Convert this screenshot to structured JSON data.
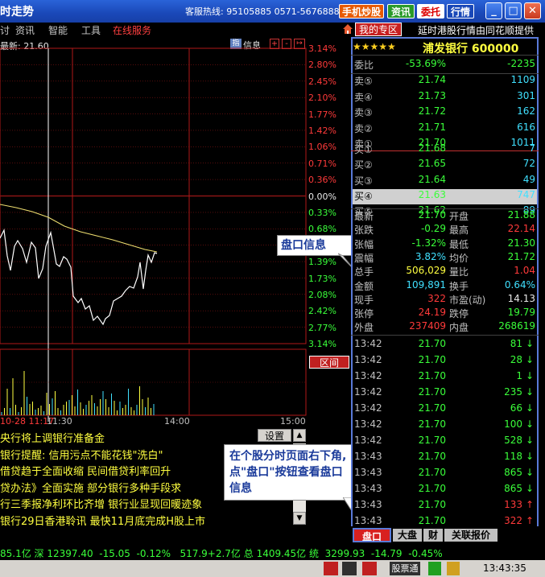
{
  "titlebar": {
    "title": "时走势",
    "hotline": "客服热线: 95105885  0571-56768888",
    "buttons": [
      "手机炒股",
      "资讯",
      "委托",
      "行情"
    ],
    "window_controls": [
      "minimize-icon",
      "maximize-icon",
      "close-icon"
    ]
  },
  "menu": {
    "items": [
      "资讯",
      "智能",
      "工具",
      "在线服务"
    ],
    "special_button": "我的专区",
    "ticker": "延时港股行情由同花顺提供"
  },
  "chart": {
    "latest": "最新: 21.60",
    "info_label": "信息",
    "right_pct": [
      "3.14%",
      "2.80%",
      "2.45%",
      "2.10%",
      "1.77%",
      "1.42%",
      "1.06%",
      "0.71%",
      "0.36%",
      "0.00%",
      "0.33%",
      "0.68%",
      "1.04%",
      "1.39%",
      "1.73%",
      "2.08%",
      "2.42%",
      "2.77%",
      "3.14%"
    ],
    "pct_colors": [
      "red",
      "red",
      "red",
      "red",
      "red",
      "red",
      "red",
      "red",
      "red",
      "white",
      "green",
      "green",
      "green",
      "green",
      "green",
      "green",
      "green",
      "green",
      "green"
    ],
    "range_button": "区间",
    "time_labels": [
      "10-28 11:17",
      "11:30",
      "14:00",
      "15:00"
    ],
    "price_line": [
      [
        0,
        296
      ],
      [
        5,
        286
      ],
      [
        9,
        318
      ],
      [
        13,
        336
      ],
      [
        18,
        306
      ],
      [
        22,
        299
      ],
      [
        28,
        309
      ],
      [
        33,
        326
      ],
      [
        39,
        301
      ],
      [
        44,
        308
      ],
      [
        48,
        346
      ],
      [
        53,
        334
      ],
      [
        57,
        306
      ],
      [
        63,
        289
      ],
      [
        67,
        311
      ],
      [
        70,
        328
      ],
      [
        74,
        331
      ],
      [
        79,
        319
      ],
      [
        83,
        322
      ],
      [
        88,
        332
      ],
      [
        91,
        368
      ],
      [
        97,
        376
      ],
      [
        101,
        371
      ],
      [
        106,
        384
      ],
      [
        111,
        380
      ],
      [
        116,
        398
      ],
      [
        121,
        393
      ],
      [
        128,
        403
      ],
      [
        131,
        396
      ],
      [
        136,
        392
      ],
      [
        141,
        374
      ],
      [
        146,
        371
      ],
      [
        151,
        368
      ],
      [
        156,
        361
      ],
      [
        161,
        356
      ],
      [
        166,
        358
      ],
      [
        171,
        344
      ],
      [
        174,
        326
      ],
      [
        178,
        359
      ],
      [
        181,
        336
      ],
      [
        184,
        317
      ],
      [
        188,
        326
      ],
      [
        192,
        314
      ],
      [
        195,
        315
      ]
    ],
    "avg_line": [
      [
        0,
        254
      ],
      [
        20,
        258
      ],
      [
        40,
        263
      ],
      [
        60,
        270
      ],
      [
        80,
        281
      ],
      [
        100,
        288
      ],
      [
        120,
        293
      ],
      [
        140,
        298
      ],
      [
        160,
        304
      ],
      [
        180,
        310
      ],
      [
        195,
        313
      ]
    ],
    "volume_bars": [
      4,
      9,
      33,
      9,
      46,
      13,
      4,
      10,
      55,
      23,
      14,
      17,
      7,
      9,
      12,
      5,
      28,
      14,
      21,
      30,
      9,
      6,
      13,
      17,
      19,
      25,
      11,
      32,
      16,
      8,
      13,
      18,
      25,
      15,
      11,
      20,
      30,
      20,
      10,
      27,
      18,
      6,
      17,
      9,
      13,
      33,
      10,
      6,
      13,
      36,
      20,
      10,
      22,
      9,
      14
    ]
  },
  "news": {
    "settings_button": "设置",
    "items": [
      "央行将上调银行准备金",
      "银行提醒: 信用污点不能花钱\"洗白\"",
      "借贷趋于全面收缩 民间借贷利率回升",
      "贷办法》全面实施 部分银行多种手段求",
      "行三季报净利环比齐增 银行业显现回暖迹象",
      "银行29日香港聆讯 最快11月底完成H股上市"
    ]
  },
  "callouts": {
    "pankou_label": "盘口信息",
    "instruction": "在个股分时页面右下角,点\"盘口\"按钮查看盘口信息"
  },
  "stock": {
    "stars": "★★★★★",
    "name": "浦发银行 600000",
    "weibi": {
      "label": "委比",
      "value": "-53.69%",
      "diff": "-2235"
    },
    "sells": [
      {
        "label": "卖⑤",
        "price": "21.74",
        "vol": "1109"
      },
      {
        "label": "卖④",
        "price": "21.73",
        "vol": "301"
      },
      {
        "label": "卖③",
        "price": "21.72",
        "vol": "162"
      },
      {
        "label": "卖②",
        "price": "21.71",
        "vol": "616"
      },
      {
        "label": "卖①",
        "price": "21.70",
        "vol": "1011"
      }
    ],
    "buys": [
      {
        "label": "买①",
        "price": "21.68",
        "vol": "7"
      },
      {
        "label": "买②",
        "price": "21.65",
        "vol": "72"
      },
      {
        "label": "买③",
        "price": "21.64",
        "vol": "49"
      },
      {
        "label": "买④",
        "price": "21.63",
        "vol": "747"
      },
      {
        "label": "买⑤",
        "price": "21.62",
        "vol": "89"
      }
    ],
    "stats": [
      {
        "l1": "最新",
        "v1": "21.70",
        "c1": "green",
        "l2": "开盘",
        "v2": "21.88",
        "c2": "green"
      },
      {
        "l1": "张跌",
        "v1": "-0.29",
        "c1": "green",
        "l2": "最高",
        "v2": "22.14",
        "c2": "red"
      },
      {
        "l1": "张幅",
        "v1": "-1.32%",
        "c1": "green",
        "l2": "最低",
        "v2": "21.30",
        "c2": "green"
      },
      {
        "l1": "震幅",
        "v1": "3.82%",
        "c1": "cyan",
        "l2": "均价",
        "v2": "21.72",
        "c2": "green"
      },
      {
        "l1": "总手",
        "v1": "506,029",
        "c1": "yellow",
        "l2": "量比",
        "v2": "1.04",
        "c2": "red"
      },
      {
        "l1": "金额",
        "v1": "109,891",
        "c1": "cyan",
        "l2": "换手",
        "v2": "0.64%",
        "c2": "cyan"
      },
      {
        "l1": "现手",
        "v1": "322",
        "c1": "red",
        "l2": "市盈(动)",
        "v2": "14.13",
        "c2": "white"
      },
      {
        "l1": "张停",
        "v1": "24.19",
        "c1": "red",
        "l2": "跌停",
        "v2": "19.79",
        "c2": "green"
      },
      {
        "l1": "外盘",
        "v1": "237409",
        "c1": "red",
        "l2": "内盘",
        "v2": "268619",
        "c2": "green"
      }
    ],
    "ticks": [
      {
        "time": "13:42",
        "price": "21.70",
        "vol": "81",
        "dir": "down"
      },
      {
        "time": "13:42",
        "price": "21.70",
        "vol": "28",
        "dir": "down"
      },
      {
        "time": "13:42",
        "price": "21.70",
        "vol": "1",
        "dir": "down"
      },
      {
        "time": "13:42",
        "price": "21.70",
        "vol": "235",
        "dir": "down"
      },
      {
        "time": "13:42",
        "price": "21.70",
        "vol": "66",
        "dir": "down"
      },
      {
        "time": "13:42",
        "price": "21.70",
        "vol": "100",
        "dir": "down"
      },
      {
        "time": "13:42",
        "price": "21.70",
        "vol": "528",
        "dir": "down"
      },
      {
        "time": "13:43",
        "price": "21.70",
        "vol": "118",
        "dir": "down"
      },
      {
        "time": "13:43",
        "price": "21.70",
        "vol": "865",
        "dir": "down"
      },
      {
        "time": "13:43",
        "price": "21.70",
        "vol": "865",
        "dir": "down"
      },
      {
        "time": "13:43",
        "price": "21.70",
        "vol": "133",
        "dir": "up"
      },
      {
        "time": "13:43",
        "price": "21.70",
        "vol": "322",
        "dir": "up"
      }
    ],
    "tabs": [
      "盘口",
      "大盘",
      "财",
      "关联报价"
    ]
  },
  "statusbar": {
    "text": "85.1亿 深 12397.40  -15.05  -0.12%   517.9+2.7亿 总 1409.45亿 统  3299.93  -14.79  -0.45%"
  },
  "bottom": {
    "clock": "13:43:35",
    "group_label": "股票通"
  }
}
